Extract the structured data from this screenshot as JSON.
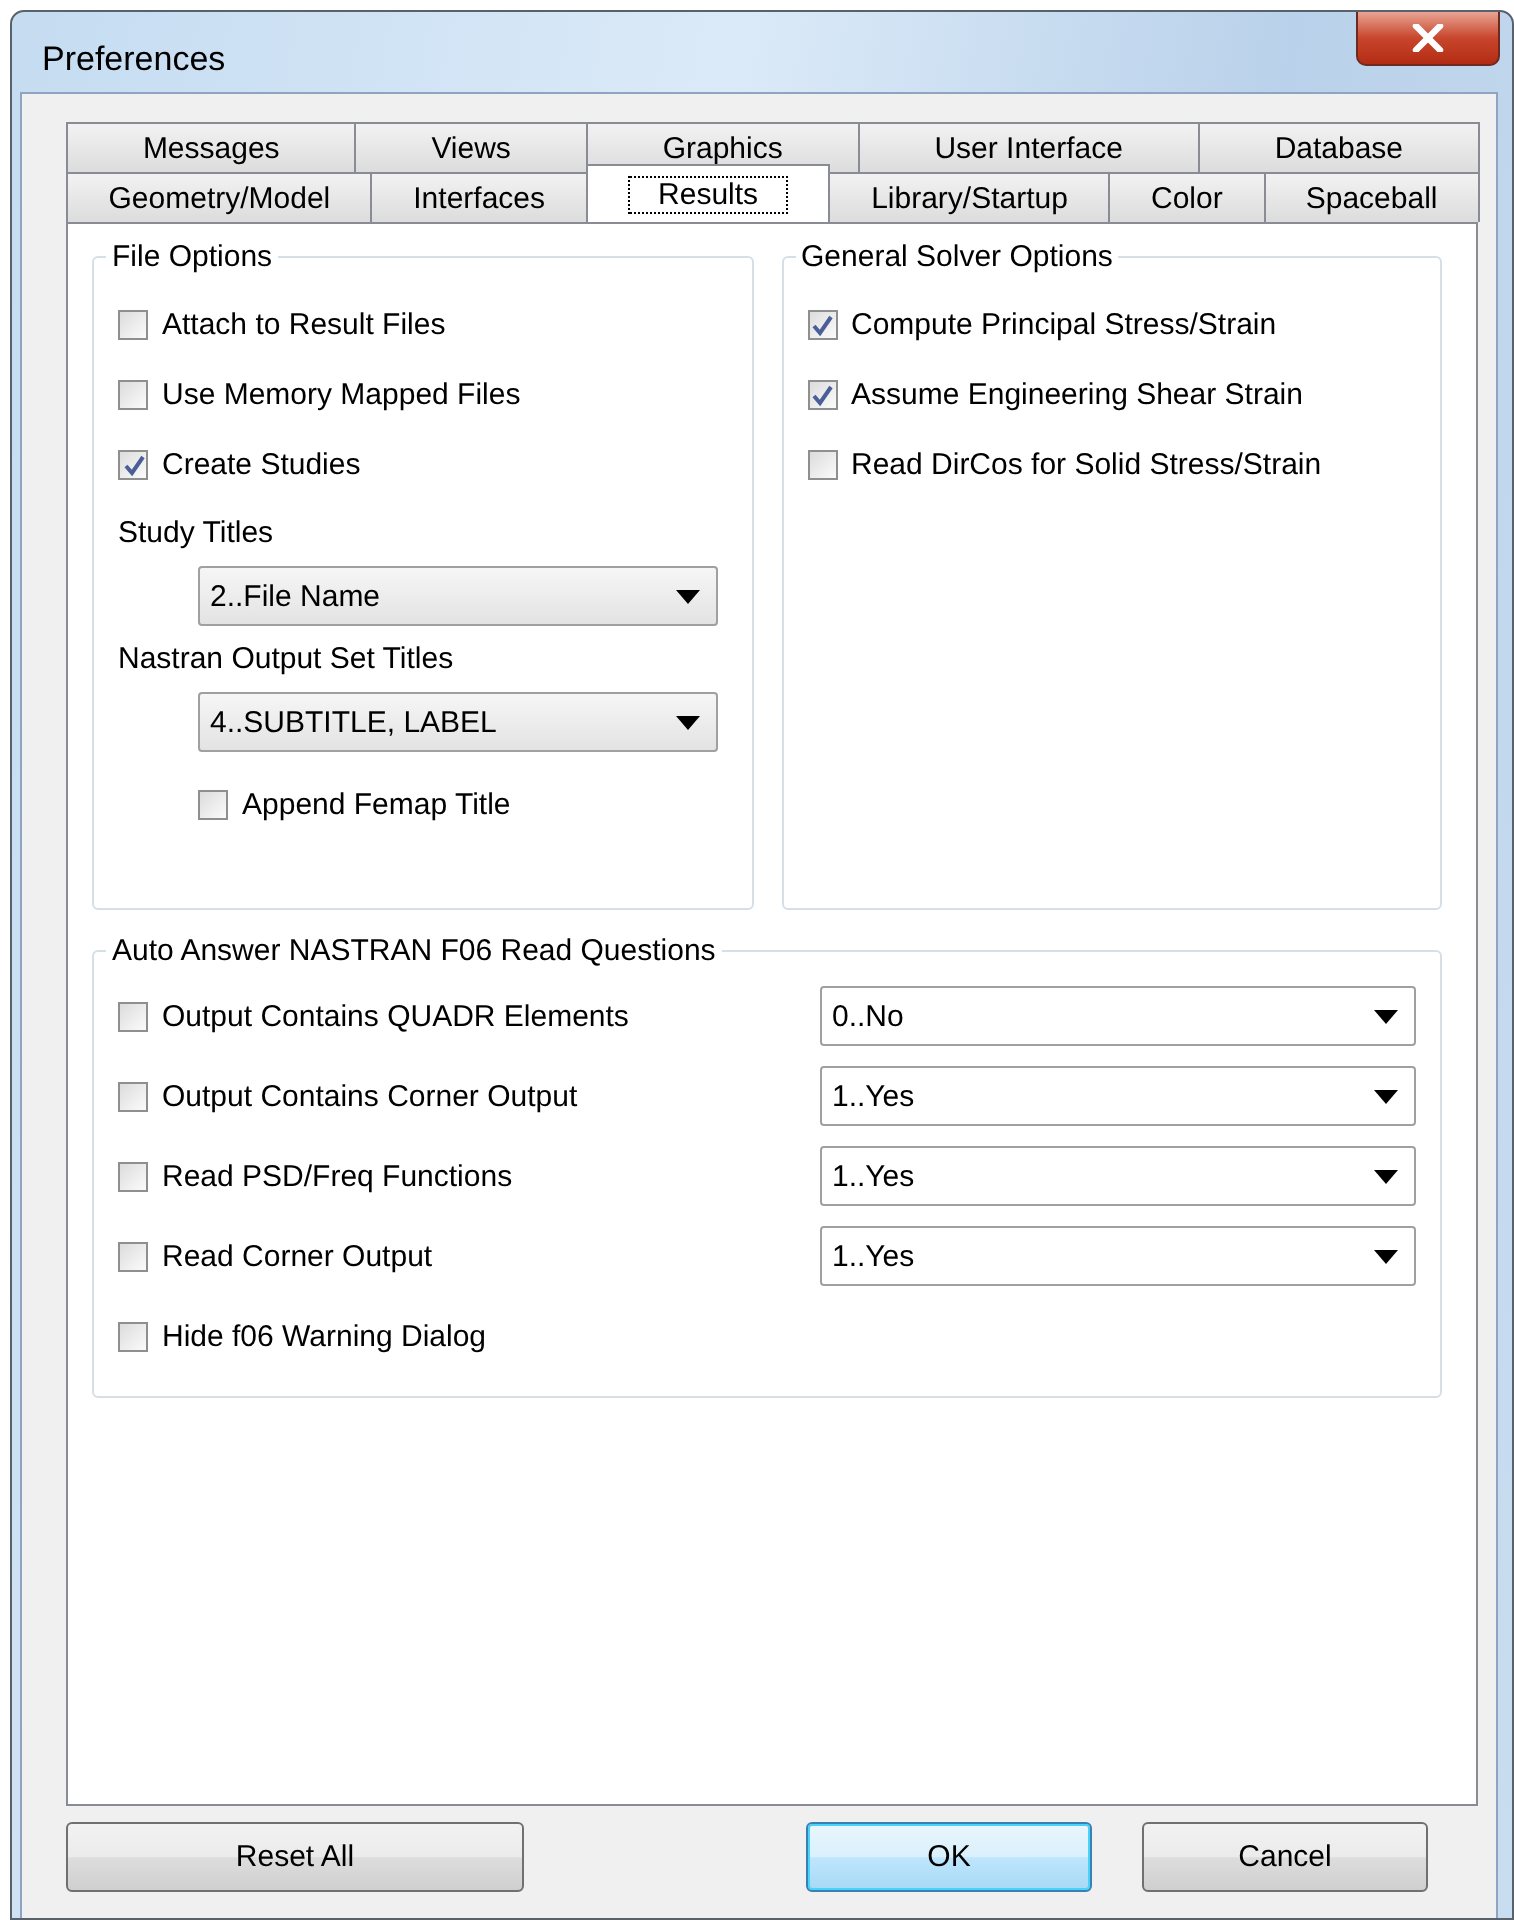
{
  "window": {
    "title": "Preferences"
  },
  "tab_rows": [
    [
      {
        "label": "Messages",
        "selected": false
      },
      {
        "label": "Views",
        "selected": false
      },
      {
        "label": "Graphics",
        "selected": false
      },
      {
        "label": "User Interface",
        "selected": false
      },
      {
        "label": "Database",
        "selected": false
      }
    ],
    [
      {
        "label": "Geometry/Model",
        "selected": false
      },
      {
        "label": "Interfaces",
        "selected": false
      },
      {
        "label": "Results",
        "selected": true
      },
      {
        "label": "Library/Startup",
        "selected": false
      },
      {
        "label": "Color",
        "selected": false
      },
      {
        "label": "Spaceball",
        "selected": false
      }
    ]
  ],
  "file_options": {
    "title": "File Options",
    "checkboxes": [
      {
        "label": "Attach to Result Files",
        "checked": false
      },
      {
        "label": "Use Memory Mapped Files",
        "checked": false
      },
      {
        "label": "Create Studies",
        "checked": true
      }
    ],
    "study_titles": {
      "label": "Study Titles",
      "value": "2..File Name"
    },
    "nastran_output_set_titles": {
      "label": "Nastran Output Set Titles",
      "value": "4..SUBTITLE, LABEL"
    },
    "append_femap_title": {
      "label": "Append Femap Title",
      "checked": false
    }
  },
  "general_solver_options": {
    "title": "General Solver Options",
    "checkboxes": [
      {
        "label": "Compute Principal Stress/Strain",
        "checked": true
      },
      {
        "label": "Assume Engineering Shear Strain",
        "checked": true
      },
      {
        "label": "Read DirCos for Solid Stress/Strain",
        "checked": false
      }
    ]
  },
  "auto_answer": {
    "title": "Auto Answer NASTRAN F06 Read Questions",
    "rows": [
      {
        "label": "Output Contains QUADR Elements",
        "checked": false,
        "value": "0..No"
      },
      {
        "label": "Output Contains Corner Output",
        "checked": false,
        "value": "1..Yes"
      },
      {
        "label": "Read PSD/Freq Functions",
        "checked": false,
        "value": "1..Yes"
      },
      {
        "label": "Read Corner Output",
        "checked": false,
        "value": "1..Yes"
      },
      {
        "label": "Hide f06 Warning Dialog",
        "checked": false
      }
    ]
  },
  "buttons_left": [
    {
      "label": "Reset All",
      "default": false
    }
  ],
  "buttons_right": [
    {
      "label": "OK",
      "default": true
    },
    {
      "label": "Cancel",
      "default": false
    }
  ]
}
